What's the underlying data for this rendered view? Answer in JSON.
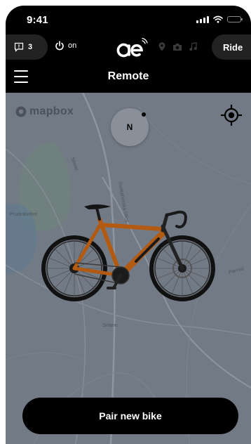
{
  "status_bar": {
    "time": "9:41"
  },
  "top_bar": {
    "notification_count": "3",
    "power_label": "on",
    "ride_label": "Ride"
  },
  "header": {
    "title": "Remote"
  },
  "map": {
    "attribution": "mapbox",
    "compass_label": "N",
    "street_labels": [
      "Slimer",
      "Svetlahvnska Ulica",
      "Prudrakellen",
      "Srilane",
      "Pannat"
    ]
  },
  "actions": {
    "pair_label": "Pair new bike"
  },
  "colors": {
    "background": "#000000",
    "map_background": "#727a85",
    "bike_frame": "#b35a12",
    "pill_background": "#222222"
  }
}
